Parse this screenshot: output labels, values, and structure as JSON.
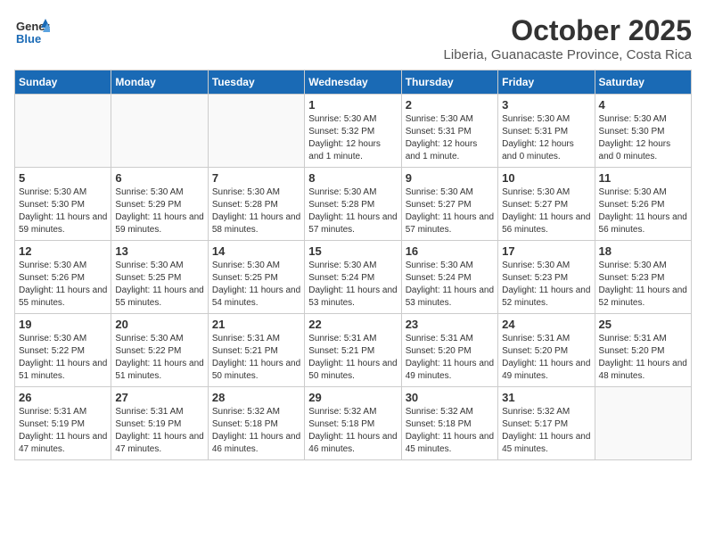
{
  "header": {
    "logo_general": "General",
    "logo_blue": "Blue",
    "month": "October 2025",
    "location": "Liberia, Guanacaste Province, Costa Rica"
  },
  "weekdays": [
    "Sunday",
    "Monday",
    "Tuesday",
    "Wednesday",
    "Thursday",
    "Friday",
    "Saturday"
  ],
  "weeks": [
    [
      {
        "day": "",
        "sunrise": "",
        "sunset": "",
        "daylight": ""
      },
      {
        "day": "",
        "sunrise": "",
        "sunset": "",
        "daylight": ""
      },
      {
        "day": "",
        "sunrise": "",
        "sunset": "",
        "daylight": ""
      },
      {
        "day": "1",
        "sunrise": "Sunrise: 5:30 AM",
        "sunset": "Sunset: 5:32 PM",
        "daylight": "Daylight: 12 hours and 1 minute."
      },
      {
        "day": "2",
        "sunrise": "Sunrise: 5:30 AM",
        "sunset": "Sunset: 5:31 PM",
        "daylight": "Daylight: 12 hours and 1 minute."
      },
      {
        "day": "3",
        "sunrise": "Sunrise: 5:30 AM",
        "sunset": "Sunset: 5:31 PM",
        "daylight": "Daylight: 12 hours and 0 minutes."
      },
      {
        "day": "4",
        "sunrise": "Sunrise: 5:30 AM",
        "sunset": "Sunset: 5:30 PM",
        "daylight": "Daylight: 12 hours and 0 minutes."
      }
    ],
    [
      {
        "day": "5",
        "sunrise": "Sunrise: 5:30 AM",
        "sunset": "Sunset: 5:30 PM",
        "daylight": "Daylight: 11 hours and 59 minutes."
      },
      {
        "day": "6",
        "sunrise": "Sunrise: 5:30 AM",
        "sunset": "Sunset: 5:29 PM",
        "daylight": "Daylight: 11 hours and 59 minutes."
      },
      {
        "day": "7",
        "sunrise": "Sunrise: 5:30 AM",
        "sunset": "Sunset: 5:28 PM",
        "daylight": "Daylight: 11 hours and 58 minutes."
      },
      {
        "day": "8",
        "sunrise": "Sunrise: 5:30 AM",
        "sunset": "Sunset: 5:28 PM",
        "daylight": "Daylight: 11 hours and 57 minutes."
      },
      {
        "day": "9",
        "sunrise": "Sunrise: 5:30 AM",
        "sunset": "Sunset: 5:27 PM",
        "daylight": "Daylight: 11 hours and 57 minutes."
      },
      {
        "day": "10",
        "sunrise": "Sunrise: 5:30 AM",
        "sunset": "Sunset: 5:27 PM",
        "daylight": "Daylight: 11 hours and 56 minutes."
      },
      {
        "day": "11",
        "sunrise": "Sunrise: 5:30 AM",
        "sunset": "Sunset: 5:26 PM",
        "daylight": "Daylight: 11 hours and 56 minutes."
      }
    ],
    [
      {
        "day": "12",
        "sunrise": "Sunrise: 5:30 AM",
        "sunset": "Sunset: 5:26 PM",
        "daylight": "Daylight: 11 hours and 55 minutes."
      },
      {
        "day": "13",
        "sunrise": "Sunrise: 5:30 AM",
        "sunset": "Sunset: 5:25 PM",
        "daylight": "Daylight: 11 hours and 55 minutes."
      },
      {
        "day": "14",
        "sunrise": "Sunrise: 5:30 AM",
        "sunset": "Sunset: 5:25 PM",
        "daylight": "Daylight: 11 hours and 54 minutes."
      },
      {
        "day": "15",
        "sunrise": "Sunrise: 5:30 AM",
        "sunset": "Sunset: 5:24 PM",
        "daylight": "Daylight: 11 hours and 53 minutes."
      },
      {
        "day": "16",
        "sunrise": "Sunrise: 5:30 AM",
        "sunset": "Sunset: 5:24 PM",
        "daylight": "Daylight: 11 hours and 53 minutes."
      },
      {
        "day": "17",
        "sunrise": "Sunrise: 5:30 AM",
        "sunset": "Sunset: 5:23 PM",
        "daylight": "Daylight: 11 hours and 52 minutes."
      },
      {
        "day": "18",
        "sunrise": "Sunrise: 5:30 AM",
        "sunset": "Sunset: 5:23 PM",
        "daylight": "Daylight: 11 hours and 52 minutes."
      }
    ],
    [
      {
        "day": "19",
        "sunrise": "Sunrise: 5:30 AM",
        "sunset": "Sunset: 5:22 PM",
        "daylight": "Daylight: 11 hours and 51 minutes."
      },
      {
        "day": "20",
        "sunrise": "Sunrise: 5:30 AM",
        "sunset": "Sunset: 5:22 PM",
        "daylight": "Daylight: 11 hours and 51 minutes."
      },
      {
        "day": "21",
        "sunrise": "Sunrise: 5:31 AM",
        "sunset": "Sunset: 5:21 PM",
        "daylight": "Daylight: 11 hours and 50 minutes."
      },
      {
        "day": "22",
        "sunrise": "Sunrise: 5:31 AM",
        "sunset": "Sunset: 5:21 PM",
        "daylight": "Daylight: 11 hours and 50 minutes."
      },
      {
        "day": "23",
        "sunrise": "Sunrise: 5:31 AM",
        "sunset": "Sunset: 5:20 PM",
        "daylight": "Daylight: 11 hours and 49 minutes."
      },
      {
        "day": "24",
        "sunrise": "Sunrise: 5:31 AM",
        "sunset": "Sunset: 5:20 PM",
        "daylight": "Daylight: 11 hours and 49 minutes."
      },
      {
        "day": "25",
        "sunrise": "Sunrise: 5:31 AM",
        "sunset": "Sunset: 5:20 PM",
        "daylight": "Daylight: 11 hours and 48 minutes."
      }
    ],
    [
      {
        "day": "26",
        "sunrise": "Sunrise: 5:31 AM",
        "sunset": "Sunset: 5:19 PM",
        "daylight": "Daylight: 11 hours and 47 minutes."
      },
      {
        "day": "27",
        "sunrise": "Sunrise: 5:31 AM",
        "sunset": "Sunset: 5:19 PM",
        "daylight": "Daylight: 11 hours and 47 minutes."
      },
      {
        "day": "28",
        "sunrise": "Sunrise: 5:32 AM",
        "sunset": "Sunset: 5:18 PM",
        "daylight": "Daylight: 11 hours and 46 minutes."
      },
      {
        "day": "29",
        "sunrise": "Sunrise: 5:32 AM",
        "sunset": "Sunset: 5:18 PM",
        "daylight": "Daylight: 11 hours and 46 minutes."
      },
      {
        "day": "30",
        "sunrise": "Sunrise: 5:32 AM",
        "sunset": "Sunset: 5:18 PM",
        "daylight": "Daylight: 11 hours and 45 minutes."
      },
      {
        "day": "31",
        "sunrise": "Sunrise: 5:32 AM",
        "sunset": "Sunset: 5:17 PM",
        "daylight": "Daylight: 11 hours and 45 minutes."
      },
      {
        "day": "",
        "sunrise": "",
        "sunset": "",
        "daylight": ""
      }
    ]
  ]
}
